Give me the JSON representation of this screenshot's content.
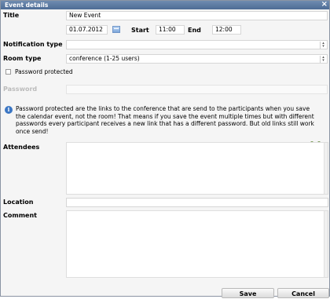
{
  "dialog": {
    "title": "Event details",
    "close_icon": "close-icon"
  },
  "form": {
    "title_label": "Title",
    "title_value": "New Event",
    "date_value": "01.07.2012",
    "start_label": "Start",
    "start_value": "11:00",
    "end_label": "End",
    "end_value": "12:00",
    "notification_label": "Notification type",
    "notification_value": "",
    "room_type_label": "Room type",
    "room_type_value": "conference (1-25 users)",
    "password_protected_label": "Password protected",
    "password_label": "Password",
    "password_value": "",
    "info_text": "Password protected are the links to the conference that are send to the participants when you save the calendar event, not the room! That means if you save the event multiple times but with different passwords every participant receives a new link that has a different password. But old links still work once send!",
    "attendees_label": "Attendees",
    "location_label": "Location",
    "location_value": "",
    "comment_label": "Comment",
    "comment_value": ""
  },
  "buttons": {
    "save": "Save",
    "cancel": "Cancel"
  },
  "icons": {
    "calendar": "calendar-icon",
    "users": "add-users-icon",
    "info": "info-icon"
  },
  "colors": {
    "titlebar": "#5a7aa3",
    "info": "#3b76c4"
  }
}
